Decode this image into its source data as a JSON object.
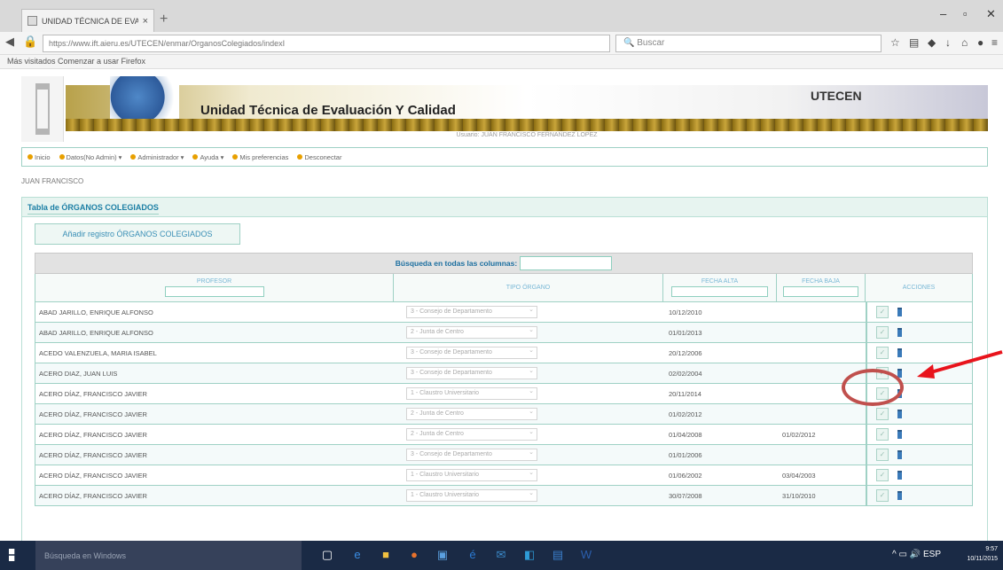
{
  "browser": {
    "tab_title": "UNIDAD TÉCNICA DE EVA...",
    "tab_close": "×",
    "new_tab": "+",
    "url": "https://www.ift.aieru.es/UTECEN/enmar/OrganosColegiados/indexI",
    "search_placeholder": "Buscar",
    "bookmarks": "Más visitados   Comenzar a usar Firefox"
  },
  "header": {
    "title": "Unidad Técnica de Evaluación Y Calidad",
    "logo_text": "UTECEN",
    "user_line": "Usuario:  JUAN FRANCISCO FERNANDEZ LOPEZ"
  },
  "menu": {
    "items": [
      "Inicio",
      "Datos(No Admin)",
      "Administrador",
      "Ayuda",
      "Mis preferencias",
      "Desconectar"
    ]
  },
  "username": "JUAN FRANCISCO",
  "panel": {
    "title": "Tabla de ÓRGANOS COLEGIADOS",
    "add_button": "Añadir registro ÓRGANOS COLEGIADOS",
    "search_label": "Búsqueda en todas las columnas:",
    "columns": [
      "PROFESOR",
      "TIPO ÓRGANO",
      "FECHA ALTA",
      "FECHA BAJA",
      "ACCIONES"
    ]
  },
  "rows": [
    {
      "profesor": "ABAD JARILLO, ENRIQUE ALFONSO",
      "tipo": "3 - Consejo de Departamento",
      "alta": "10/12/2010",
      "baja": ""
    },
    {
      "profesor": "ABAD JARILLO, ENRIQUE ALFONSO",
      "tipo": "2 - Junta de Centro",
      "alta": "01/01/2013",
      "baja": ""
    },
    {
      "profesor": "ACEDO VALENZUELA, MARIA ISABEL",
      "tipo": "3 - Consejo de Departamento",
      "alta": "20/12/2006",
      "baja": ""
    },
    {
      "profesor": "ACERO DIAZ, JUAN LUIS",
      "tipo": "3 - Consejo de Departamento",
      "alta": "02/02/2004",
      "baja": ""
    },
    {
      "profesor": "ACERO DÍAZ, FRANCISCO JAVIER",
      "tipo": "1 - Claustro Universitario",
      "alta": "20/11/2014",
      "baja": ""
    },
    {
      "profesor": "ACERO DÍAZ, FRANCISCO JAVIER",
      "tipo": "2 - Junta de Centro",
      "alta": "01/02/2012",
      "baja": ""
    },
    {
      "profesor": "ACERO DÍAZ, FRANCISCO JAVIER",
      "tipo": "2 - Junta de Centro",
      "alta": "01/04/2008",
      "baja": "01/02/2012"
    },
    {
      "profesor": "ACERO DÍAZ, FRANCISCO JAVIER",
      "tipo": "3 - Consejo de Departamento",
      "alta": "01/01/2006",
      "baja": ""
    },
    {
      "profesor": "ACERO DÍAZ, FRANCISCO JAVIER",
      "tipo": "1 - Claustro Universitario",
      "alta": "01/06/2002",
      "baja": "03/04/2003"
    },
    {
      "profesor": "ACERO DÍAZ, FRANCISCO JAVIER",
      "tipo": "1 - Claustro Universitario",
      "alta": "30/07/2008",
      "baja": "31/10/2010"
    }
  ],
  "taskbar": {
    "search": "Búsqueda en Windows",
    "tray": "ESP",
    "time": "9:57",
    "date": "10/11/2015"
  },
  "colors": {
    "accent": "#9fd1c5",
    "annotation": "#c0504d",
    "arrow": "#e8141c"
  }
}
